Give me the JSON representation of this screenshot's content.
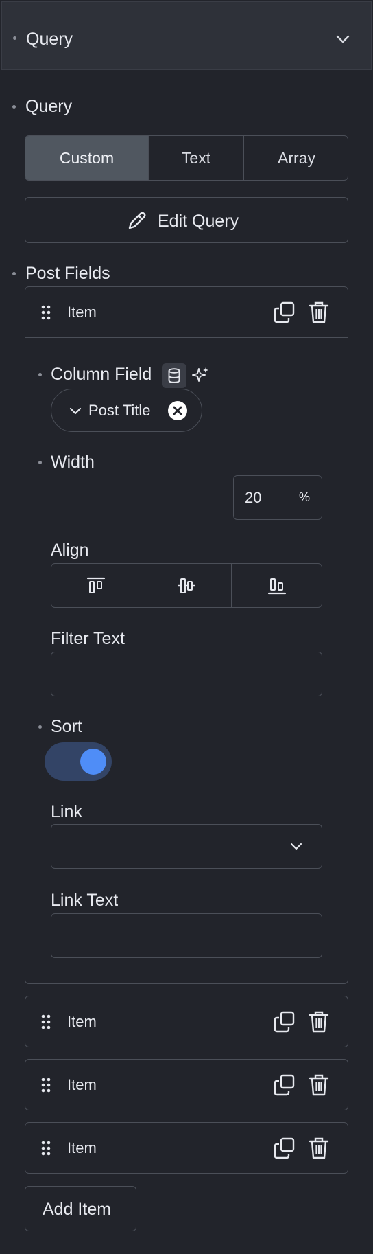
{
  "header": {
    "title": "Query"
  },
  "query": {
    "label": "Query",
    "tabs": [
      "Custom",
      "Text",
      "Array"
    ],
    "active_tab": "Custom",
    "edit_button": "Edit Query"
  },
  "post_fields": {
    "label": "Post Fields",
    "expanded_item": {
      "title": "Item",
      "column_field": {
        "label": "Column Field",
        "value": "Post Title"
      },
      "width": {
        "label": "Width",
        "value": "20",
        "unit": "%"
      },
      "align": {
        "label": "Align"
      },
      "filter_text": {
        "label": "Filter Text",
        "value": ""
      },
      "sort": {
        "label": "Sort",
        "on": true
      },
      "link": {
        "label": "Link",
        "value": ""
      },
      "link_text": {
        "label": "Link Text",
        "value": ""
      }
    },
    "items": [
      {
        "title": "Item"
      },
      {
        "title": "Item"
      },
      {
        "title": "Item"
      }
    ],
    "add_button": "Add Item"
  },
  "colors": {
    "accent": "#4f8df7",
    "background": "#22242b",
    "header": "#2e3139"
  }
}
